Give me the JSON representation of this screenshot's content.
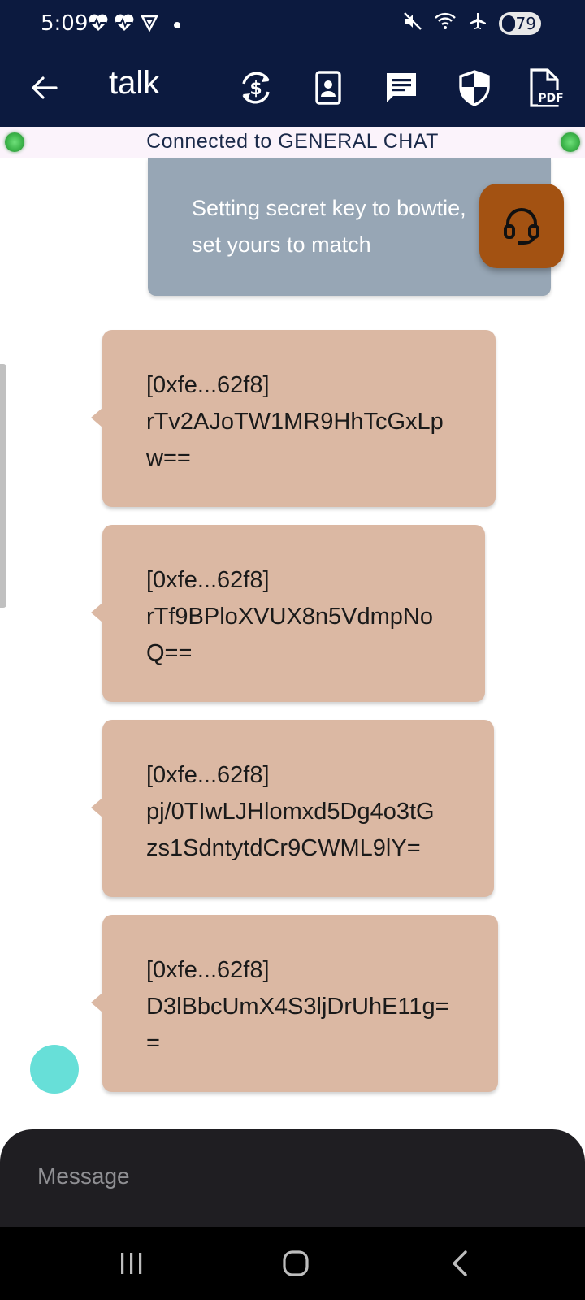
{
  "status_bar": {
    "time": "5:09",
    "battery_level": "79",
    "left_icons": [
      "heart-pulse-icon",
      "heart-pulse-icon",
      "vpn-shield-icon",
      "notification-dot"
    ],
    "right_icons": [
      "mute-icon",
      "wifi-icon",
      "airplane-icon",
      "battery-icon"
    ]
  },
  "app_bar": {
    "title": "talk",
    "back_icon": "arrow-left-icon",
    "actions": [
      "currency-sync-icon",
      "contact-card-icon",
      "chat-icon",
      "shield-icon",
      "pdf-icon"
    ]
  },
  "connection": {
    "text": "Connected to GENERAL CHAT",
    "status_color": "#3db54b"
  },
  "messages": [
    {
      "direction": "outgoing",
      "lines": [
        "Setting secret key to bowtie,",
        "set yours to match"
      ]
    },
    {
      "direction": "incoming",
      "lines": [
        "[0xfe...62f8]",
        "rTv2AJoTW1MR9HhTcGxLp",
        "w=="
      ]
    },
    {
      "direction": "incoming",
      "lines": [
        "[0xfe...62f8]",
        "rTf9BPloXVUX8n5VdmpNo",
        "Q=="
      ]
    },
    {
      "direction": "incoming",
      "lines": [
        "[0xfe...62f8]",
        "pj/0TIwLJHlomxd5Dg4o3tG",
        "zs1SdntytdCr9CWML9lY="
      ]
    },
    {
      "direction": "incoming",
      "lines": [
        "[0xfe...62f8]",
        "D3lBbcUmX4S3ljDrUhE11g=",
        "="
      ]
    }
  ],
  "support_button": {
    "icon": "headset-icon"
  },
  "composer": {
    "placeholder": "Message",
    "value": ""
  },
  "nav_bar": {
    "buttons": [
      "recent-apps-icon",
      "home-icon",
      "back-icon"
    ]
  },
  "colors": {
    "header_bg": "#0c1a3f",
    "outgoing_bubble": "#97a6b5",
    "incoming_bubble": "#dbb8a3",
    "support_fab": "#a35212",
    "avatar": "#67dfd8",
    "composer_bg": "#1f1e22"
  }
}
